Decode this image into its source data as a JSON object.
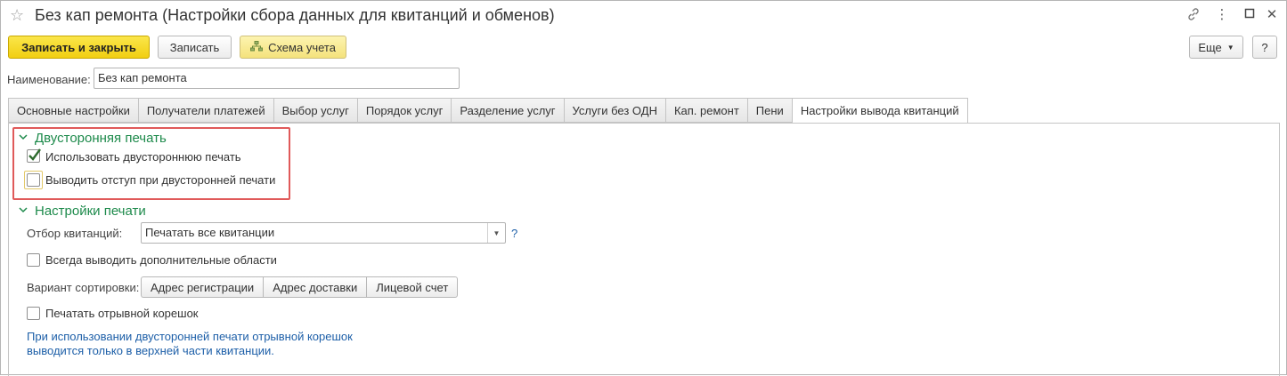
{
  "window": {
    "title": "Без кап ремонта (Настройки сбора данных для квитанций и обменов)"
  },
  "toolbar": {
    "save_close_label": "Записать и закрыть",
    "save_label": "Записать",
    "scheme_label": "Схема учета",
    "more_label": "Еще",
    "help_label": "?"
  },
  "name_field": {
    "label": "Наименование:",
    "value": "Без кап ремонта"
  },
  "tabs": [
    {
      "label": "Основные настройки"
    },
    {
      "label": "Получатели платежей"
    },
    {
      "label": "Выбор услуг"
    },
    {
      "label": "Порядок услуг"
    },
    {
      "label": "Разделение услуг"
    },
    {
      "label": "Услуги без ОДН"
    },
    {
      "label": "Кап. ремонт"
    },
    {
      "label": "Пени"
    },
    {
      "label": "Настройки вывода квитанций"
    }
  ],
  "duplex_group": {
    "title": "Двусторонняя печать",
    "use_duplex": {
      "label": "Использовать двустороннюю печать",
      "checked": true
    },
    "indent_duplex": {
      "label": "Выводить отступ при двусторонней печати",
      "checked": false
    }
  },
  "print_group": {
    "title": "Настройки печати",
    "filter": {
      "label": "Отбор квитанций:",
      "value": "Печатать все квитанции",
      "help": "?"
    },
    "always_extra": {
      "label": "Всегда выводить дополнительные области",
      "checked": false
    },
    "sort": {
      "label": "Вариант сортировки:",
      "options": [
        "Адрес регистрации",
        "Адрес доставки",
        "Лицевой счет"
      ]
    },
    "tear_off": {
      "label": "Печатать отрывной корешок",
      "checked": false
    },
    "note_line1": "При использовании двусторонней печати отрывной корешок",
    "note_line2": "выводится только в верхней части квитанции."
  },
  "colors": {
    "accent_green": "#1d8a4b",
    "primary_yellow": "#f1cf12",
    "highlight_red": "#e05a5a",
    "note_blue": "#1d5fa8"
  },
  "icons": [
    "star-icon",
    "link-icon",
    "more-vertical-icon",
    "maximize-icon",
    "close-icon",
    "scheme-icon",
    "chevron-down-icon",
    "checkmark-icon"
  ]
}
